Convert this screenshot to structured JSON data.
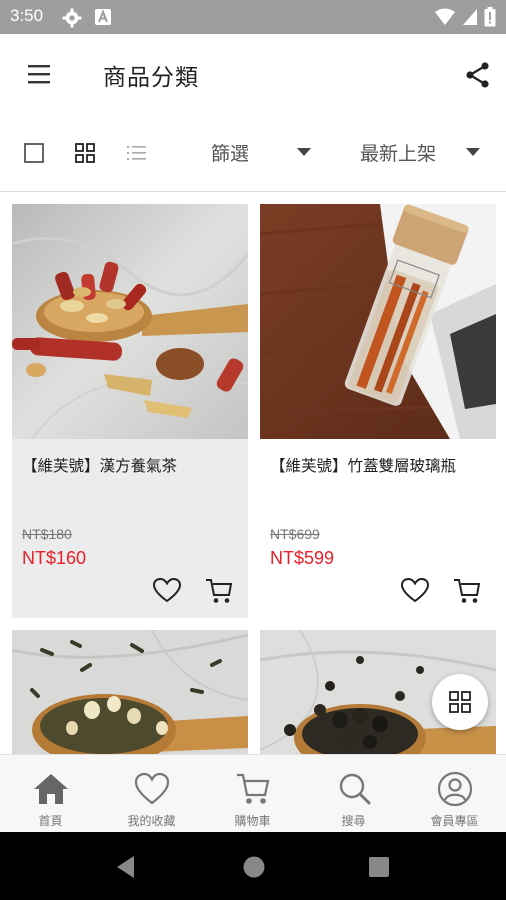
{
  "status_bar": {
    "time": "3:50"
  },
  "header": {
    "title": "商品分類"
  },
  "toolbar": {
    "filter_label": "篩選",
    "sort_label": "最新上架"
  },
  "products": [
    {
      "name": "【維芙號】漢方養氣茶",
      "original_price": "NT$180",
      "price": "NT$160"
    },
    {
      "name": "【維芙號】竹蓋雙層玻璃瓶",
      "original_price": "NT$699",
      "price": "NT$599"
    },
    {
      "name": "",
      "original_price": "",
      "price": ""
    },
    {
      "name": "",
      "original_price": "",
      "price": ""
    }
  ],
  "bottom_nav": [
    {
      "label": "首頁",
      "icon": "home-icon"
    },
    {
      "label": "我的收藏",
      "icon": "heart-icon"
    },
    {
      "label": "購物車",
      "icon": "cart-icon"
    },
    {
      "label": "搜尋",
      "icon": "search-icon"
    },
    {
      "label": "會員專區",
      "icon": "user-icon"
    }
  ],
  "colors": {
    "sale_price": "#e8202a",
    "status_bar": "#9e9e9e",
    "active_nav": "#666666"
  }
}
